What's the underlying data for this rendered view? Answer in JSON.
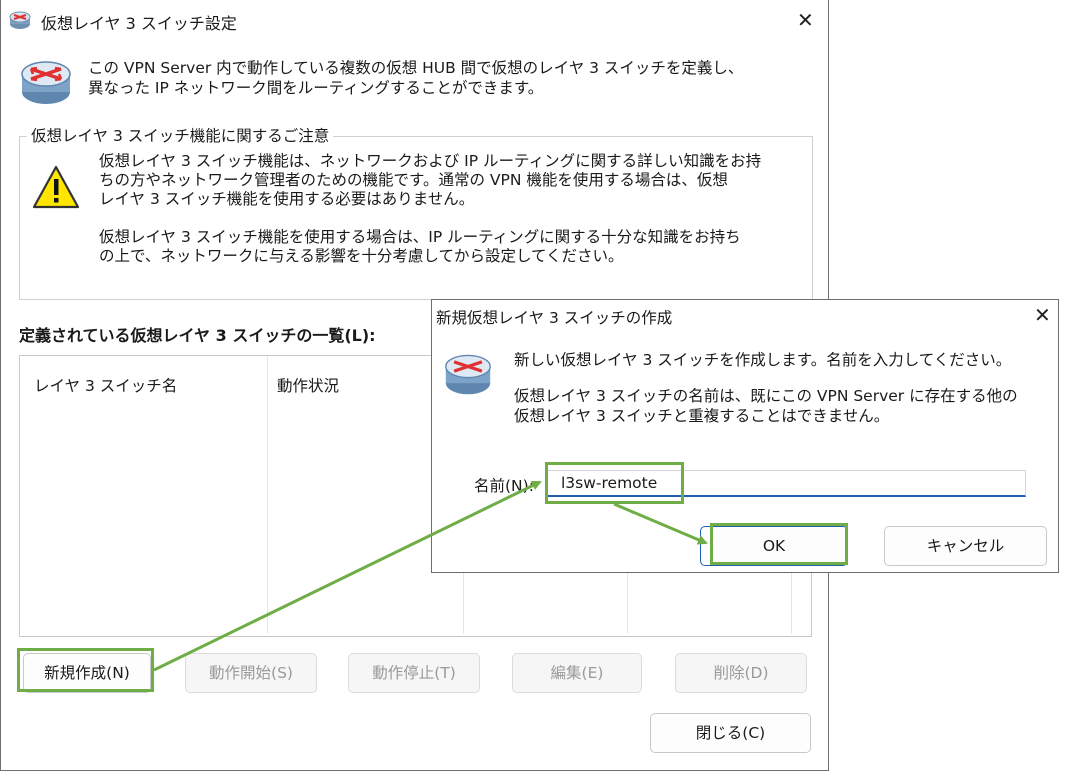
{
  "main_window": {
    "title": "仮想レイヤ 3 スイッチ設定",
    "intro_line1": "この VPN Server 内で動作している複数の仮想 HUB 間で仮想のレイヤ 3 スイッチを定義し、",
    "intro_line2": "異なった IP ネットワーク間をルーティングすることができます。",
    "caution_title": "仮想レイヤ 3 スイッチ機能に関するご注意",
    "caution_p1_line1": "仮想レイヤ 3 スイッチ機能は、ネットワークおよび IP ルーティングに関する詳しい知識をお持",
    "caution_p1_line2": "ちの方やネットワーク管理者のための機能です。通常の VPN 機能を使用する場合は、仮想",
    "caution_p1_line3": "レイヤ 3 スイッチ機能を使用する必要はありません。",
    "caution_p2_line1": "仮想レイヤ 3 スイッチ機能を使用する場合は、IP ルーティングに関する十分な知識をお持ち",
    "caution_p2_line2": "の上で、ネットワークに与える影響を十分考慮してから設定してください。",
    "list_label": "定義されている仮想レイヤ 3 スイッチの一覧(L):",
    "columns": [
      "レイヤ 3 スイッチ名",
      "動作状況"
    ],
    "buttons": {
      "new": "新規作成(N)",
      "start": "動作開始(S)",
      "stop": "動作停止(T)",
      "edit": "編集(E)",
      "delete": "削除(D)",
      "close": "閉じる(C)"
    }
  },
  "dialog": {
    "title": "新規仮想レイヤ 3 スイッチの作成",
    "message1": "新しい仮想レイヤ 3 スイッチを作成します。名前を入力してください。",
    "message2_line1": "仮想レイヤ 3 スイッチの名前は、既にこの VPN Server に存在する他の",
    "message2_line2": "仮想レイヤ 3 スイッチと重複することはできません。",
    "name_label": "名前(N):",
    "name_value": "l3sw-remote",
    "ok": "OK",
    "cancel": "キャンセル"
  },
  "colors": {
    "highlight": "#70ad47",
    "focus_underline": "#1f5fb0",
    "warning_yellow": "#ffe600"
  }
}
